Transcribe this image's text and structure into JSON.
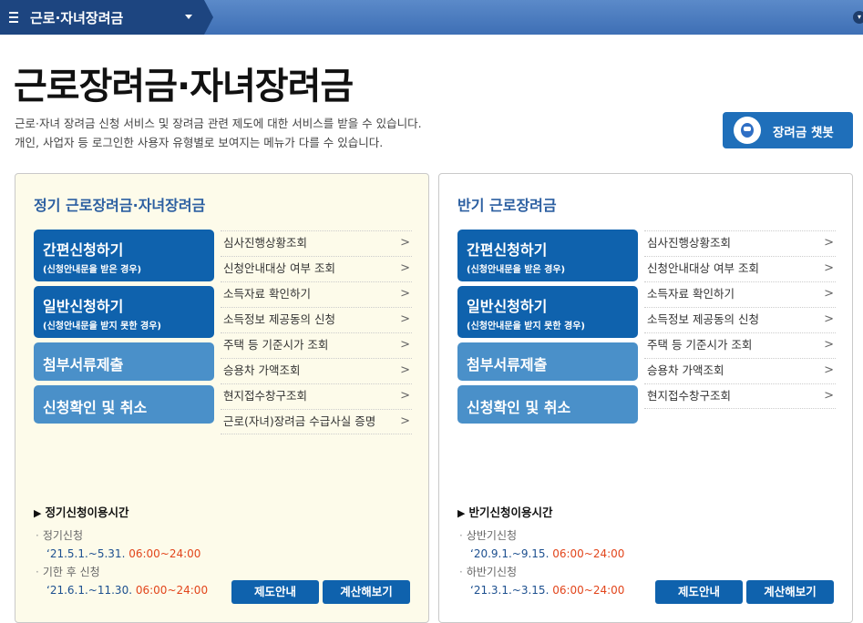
{
  "topbar": {
    "menu_title": "근로·자녀장려금"
  },
  "header": {
    "title": "근로장려금·자녀장려금",
    "desc_line1": "근로·자녀 장려금 신청 서비스 및 장려금 관련 제도에 대한 서비스를 받을 수 있습니다.",
    "desc_line2": "개인, 사업자 등 로그인한 사용자 유형별로 보여지는 메뉴가 다를 수 있습니다.",
    "chatbot_label": "장려금 챗봇"
  },
  "left": {
    "title": "정기 근로장려금·자녀장려금",
    "btn_simple": "간편신청하기",
    "btn_simple_sub": "(신청안내문을 받은 경우)",
    "btn_general": "일반신청하기",
    "btn_general_sub": "(신청안내문을 받지 못한 경우)",
    "btn_docs": "첨부서류제출",
    "btn_confirm": "신청확인 및 취소",
    "links": [
      "심사진행상황조회",
      "신청안내대상 여부 조회",
      "소득자료 확인하기",
      "소득정보 제공동의 신청",
      "주택 등 기준시가 조회",
      "승용차 가액조회",
      "현지접수창구조회",
      "근로(자녀)장려금 수급사실 증명"
    ],
    "hours_title": "정기신청이용시간",
    "h1_label": "정기신청",
    "h1_date": "‘21.5.1.~5.31.",
    "h1_time": "06:00~24:00",
    "h2_label": "기한 후 신청",
    "h2_date": "‘21.6.1.~11.30.",
    "h2_time": "06:00~24:00",
    "btn_info": "제도안내",
    "btn_calc": "계산해보기"
  },
  "right": {
    "title": "반기 근로장려금",
    "btn_simple": "간편신청하기",
    "btn_simple_sub": "(신청안내문을 받은 경우)",
    "btn_general": "일반신청하기",
    "btn_general_sub": "(신청안내문을 받지 못한 경우)",
    "btn_docs": "첨부서류제출",
    "btn_confirm": "신청확인 및 취소",
    "links": [
      "심사진행상황조회",
      "신청안내대상 여부 조회",
      "소득자료 확인하기",
      "소득정보 제공동의 신청",
      "주택 등 기준시가 조회",
      "승용차 가액조회",
      "현지접수창구조회"
    ],
    "hours_title": "반기신청이용시간",
    "h1_label": "상반기신청",
    "h1_date": "‘20.9.1.~9.15.",
    "h1_time": "06:00~24:00",
    "h2_label": "하반기신청",
    "h2_date": "‘21.3.1.~3.15.",
    "h2_time": "06:00~24:00",
    "btn_info": "제도안내",
    "btn_calc": "계산해보기"
  },
  "colors": {
    "primary": "#0f62ad",
    "secondary": "#4a90c9",
    "time": "#e2451b",
    "left_bg": "#fdfbea"
  }
}
